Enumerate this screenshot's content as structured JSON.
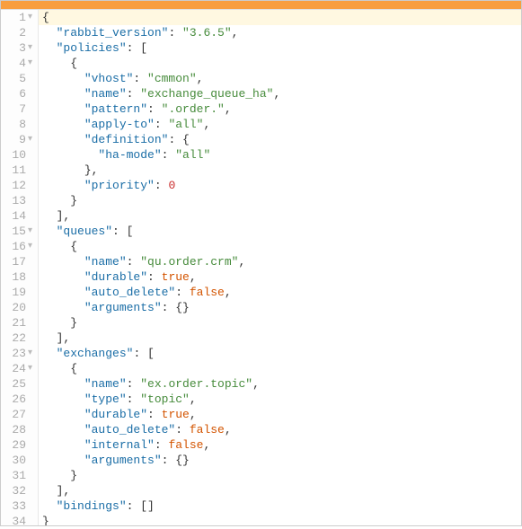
{
  "gutter": {
    "lines": [
      {
        "n": "1",
        "fold": true
      },
      {
        "n": "2",
        "fold": false
      },
      {
        "n": "3",
        "fold": true
      },
      {
        "n": "4",
        "fold": true
      },
      {
        "n": "5",
        "fold": false
      },
      {
        "n": "6",
        "fold": false
      },
      {
        "n": "7",
        "fold": false
      },
      {
        "n": "8",
        "fold": false
      },
      {
        "n": "9",
        "fold": true
      },
      {
        "n": "10",
        "fold": false
      },
      {
        "n": "11",
        "fold": false
      },
      {
        "n": "12",
        "fold": false
      },
      {
        "n": "13",
        "fold": false
      },
      {
        "n": "14",
        "fold": false
      },
      {
        "n": "15",
        "fold": true
      },
      {
        "n": "16",
        "fold": true
      },
      {
        "n": "17",
        "fold": false
      },
      {
        "n": "18",
        "fold": false
      },
      {
        "n": "19",
        "fold": false
      },
      {
        "n": "20",
        "fold": false
      },
      {
        "n": "21",
        "fold": false
      },
      {
        "n": "22",
        "fold": false
      },
      {
        "n": "23",
        "fold": true
      },
      {
        "n": "24",
        "fold": true
      },
      {
        "n": "25",
        "fold": false
      },
      {
        "n": "26",
        "fold": false
      },
      {
        "n": "27",
        "fold": false
      },
      {
        "n": "28",
        "fold": false
      },
      {
        "n": "29",
        "fold": false
      },
      {
        "n": "30",
        "fold": false
      },
      {
        "n": "31",
        "fold": false
      },
      {
        "n": "32",
        "fold": false
      },
      {
        "n": "33",
        "fold": false
      },
      {
        "n": "34",
        "fold": false
      }
    ]
  },
  "code": {
    "l1": {
      "indent": "",
      "p": "{"
    },
    "l2": {
      "indent": "  ",
      "k": "\"rabbit_version\"",
      "c": ": ",
      "v": "\"3.6.5\"",
      "t": ","
    },
    "l3": {
      "indent": "  ",
      "k": "\"policies\"",
      "c": ": [",
      "t": ""
    },
    "l4": {
      "indent": "    ",
      "p": "{"
    },
    "l5": {
      "indent": "      ",
      "k": "\"vhost\"",
      "c": ": ",
      "v": "\"cmmon\"",
      "t": ","
    },
    "l6": {
      "indent": "      ",
      "k": "\"name\"",
      "c": ": ",
      "v": "\"exchange_queue_ha\"",
      "t": ","
    },
    "l7": {
      "indent": "      ",
      "k": "\"pattern\"",
      "c": ": ",
      "v": "\".order.\"",
      "t": ","
    },
    "l8": {
      "indent": "      ",
      "k": "\"apply-to\"",
      "c": ": ",
      "v": "\"all\"",
      "t": ","
    },
    "l9": {
      "indent": "      ",
      "k": "\"definition\"",
      "c": ": {",
      "t": ""
    },
    "l10": {
      "indent": "        ",
      "k": "\"ha-mode\"",
      "c": ": ",
      "v": "\"all\"",
      "t": ""
    },
    "l11": {
      "indent": "      ",
      "p": "},"
    },
    "l12": {
      "indent": "      ",
      "k": "\"priority\"",
      "c": ": ",
      "n": "0",
      "t": ""
    },
    "l13": {
      "indent": "    ",
      "p": "}"
    },
    "l14": {
      "indent": "  ",
      "p": "],"
    },
    "l15": {
      "indent": "  ",
      "k": "\"queues\"",
      "c": ": [",
      "t": ""
    },
    "l16": {
      "indent": "    ",
      "p": "{"
    },
    "l17": {
      "indent": "      ",
      "k": "\"name\"",
      "c": ": ",
      "v": "\"qu.order.crm\"",
      "t": ","
    },
    "l18": {
      "indent": "      ",
      "k": "\"durable\"",
      "c": ": ",
      "b": "true",
      "t": ","
    },
    "l19": {
      "indent": "      ",
      "k": "\"auto_delete\"",
      "c": ": ",
      "b": "false",
      "t": ","
    },
    "l20": {
      "indent": "      ",
      "k": "\"arguments\"",
      "c": ": {}",
      "t": ""
    },
    "l21": {
      "indent": "    ",
      "p": "}"
    },
    "l22": {
      "indent": "  ",
      "p": "],"
    },
    "l23": {
      "indent": "  ",
      "k": "\"exchanges\"",
      "c": ": [",
      "t": ""
    },
    "l24": {
      "indent": "    ",
      "p": "{"
    },
    "l25": {
      "indent": "      ",
      "k": "\"name\"",
      "c": ": ",
      "v": "\"ex.order.topic\"",
      "t": ","
    },
    "l26": {
      "indent": "      ",
      "k": "\"type\"",
      "c": ": ",
      "v": "\"topic\"",
      "t": ","
    },
    "l27": {
      "indent": "      ",
      "k": "\"durable\"",
      "c": ": ",
      "b": "true",
      "t": ","
    },
    "l28": {
      "indent": "      ",
      "k": "\"auto_delete\"",
      "c": ": ",
      "b": "false",
      "t": ","
    },
    "l29": {
      "indent": "      ",
      "k": "\"internal\"",
      "c": ": ",
      "b": "false",
      "t": ","
    },
    "l30": {
      "indent": "      ",
      "k": "\"arguments\"",
      "c": ": {}",
      "t": ""
    },
    "l31": {
      "indent": "    ",
      "p": "}"
    },
    "l32": {
      "indent": "  ",
      "p": "],"
    },
    "l33": {
      "indent": "  ",
      "k": "\"bindings\"",
      "c": ": []",
      "t": ""
    },
    "l34": {
      "indent": "",
      "p": "}"
    }
  }
}
